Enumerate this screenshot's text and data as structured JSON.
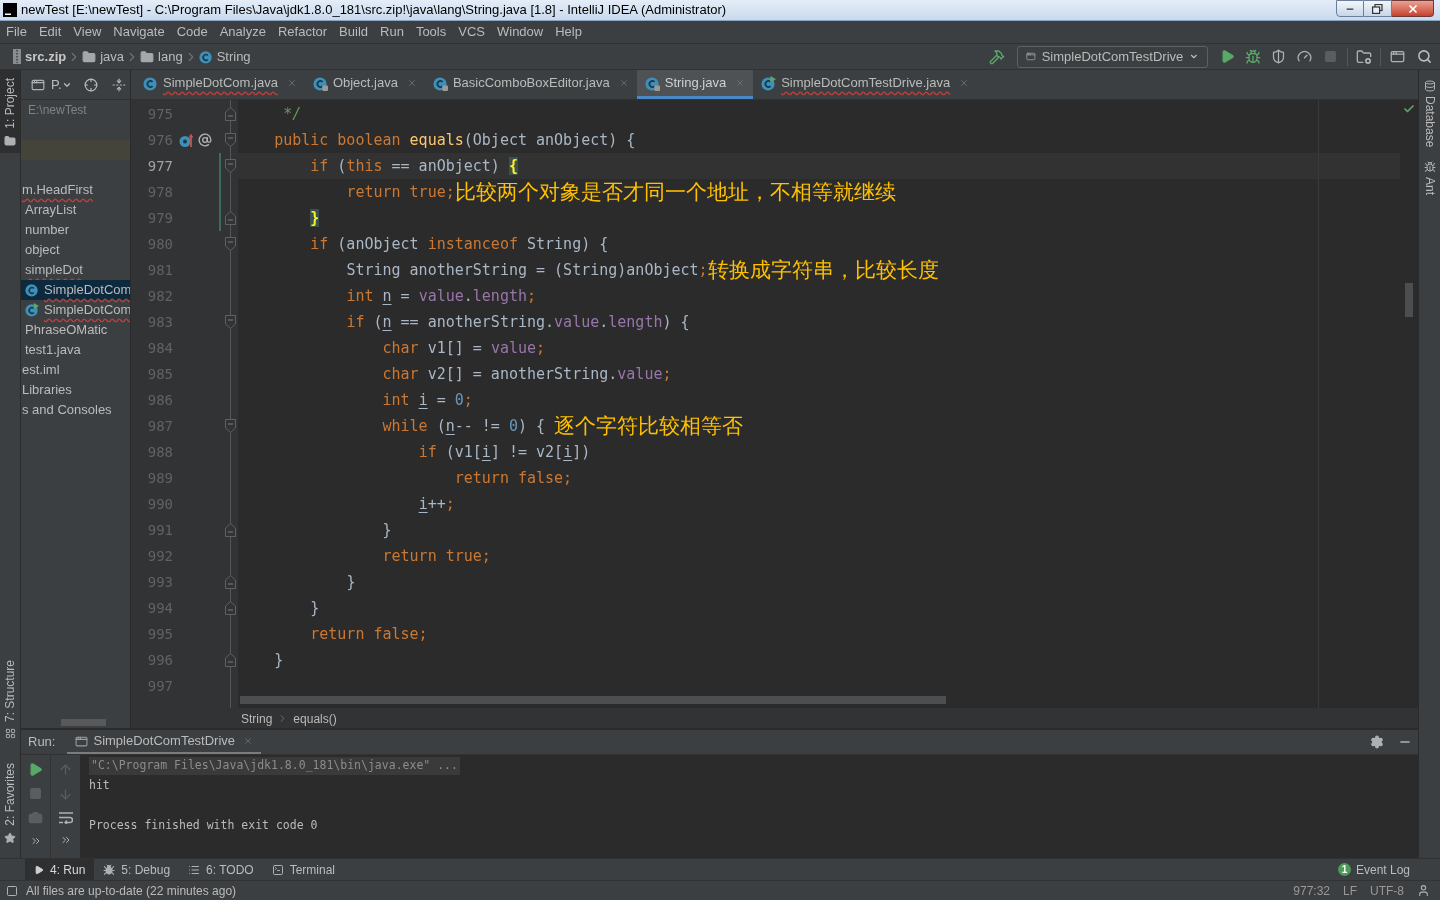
{
  "window": {
    "title": "newTest [E:\\newTest] - C:\\Program Files\\Java\\jdk1.8.0_181\\src.zip!\\java\\lang\\String.java [1.8] - IntelliJ IDEA (Administrator)"
  },
  "menu": [
    "File",
    "Edit",
    "View",
    "Navigate",
    "Code",
    "Analyze",
    "Refactor",
    "Build",
    "Run",
    "Tools",
    "VCS",
    "Window",
    "Help"
  ],
  "navigation": [
    {
      "label": "src.zip",
      "kind": "archive"
    },
    {
      "label": "java",
      "kind": "folder"
    },
    {
      "label": "lang",
      "kind": "folder"
    },
    {
      "label": "String",
      "kind": "class"
    }
  ],
  "run_configuration": {
    "label": "SimpleDotComTestDrive"
  },
  "left_tool_windows": [
    {
      "label": "1: Project",
      "kind": "project",
      "selected": true
    },
    {
      "label": "7: Structure",
      "kind": "structure",
      "selected": false
    },
    {
      "label": "2: Favorites",
      "kind": "favorites",
      "selected": false
    }
  ],
  "right_tool_windows": [
    {
      "label": "Database",
      "kind": "database"
    },
    {
      "label": "Ant",
      "kind": "ant"
    }
  ],
  "project_panel": {
    "view": "P.",
    "root_path": "E:\\newTest",
    "tree": [
      {
        "label": "m.HeadFirst",
        "kind": "plain",
        "error": true,
        "selected": false,
        "children": [
          {
            "label": "ArrayList",
            "kind": "plain",
            "error": false,
            "selected": false
          },
          {
            "label": "number",
            "kind": "plain",
            "error": false,
            "selected": false
          },
          {
            "label": "object",
            "kind": "plain",
            "error": false,
            "selected": false
          },
          {
            "label": "simpleDot",
            "kind": "plain",
            "error": true,
            "selected": false
          },
          {
            "label": "SimpleDotCom",
            "kind": "class",
            "error": true,
            "selected": true
          },
          {
            "label": "SimpleDotCom",
            "kind": "class_run",
            "error": true,
            "selected": false
          },
          {
            "label": "PhraseOMatic",
            "kind": "plain",
            "error": false,
            "selected": false
          },
          {
            "label": "test1.java",
            "kind": "plain",
            "error": false,
            "selected": false
          }
        ]
      },
      {
        "label": "est.iml",
        "kind": "plain",
        "error": false,
        "selected": false
      },
      {
        "label": "Libraries",
        "kind": "plain",
        "error": false,
        "selected": false
      },
      {
        "label": "s and Consoles",
        "kind": "plain",
        "error": false,
        "selected": false
      }
    ]
  },
  "tabs": [
    {
      "label": "SimpleDotCom.java",
      "kind": "class",
      "error": true,
      "selected": false
    },
    {
      "label": "Object.java",
      "kind": "class_locked",
      "error": false,
      "selected": false
    },
    {
      "label": "BasicComboBoxEditor.java",
      "kind": "class_locked",
      "error": false,
      "selected": false
    },
    {
      "label": "String.java",
      "kind": "class_locked",
      "error": false,
      "selected": true
    },
    {
      "label": "SimpleDotComTestDrive.java",
      "kind": "class_run",
      "error": true,
      "selected": false
    }
  ],
  "editor": {
    "lines": [
      {
        "number": "975",
        "current": false,
        "gutter_marks": [
          {
            "kind": "fold_end"
          }
        ],
        "tokens": [
          {
            "text": "     */",
            "kind": "comment"
          }
        ]
      },
      {
        "number": "976",
        "current": false,
        "gutter_marks": [
          {
            "kind": "override"
          },
          {
            "kind": "annotation"
          },
          {
            "kind": "fold_start"
          }
        ],
        "tokens": [
          {
            "text": "    public boolean ",
            "kind": "keyword"
          },
          {
            "text": "equals",
            "kind": "method"
          },
          {
            "text": "(Object anObject) {",
            "kind": "plain"
          }
        ]
      },
      {
        "number": "977",
        "current": true,
        "gutter_marks": [
          {
            "kind": "change"
          },
          {
            "kind": "fold_start"
          }
        ],
        "tokens": [
          {
            "text": "        if ",
            "kind": "keyword"
          },
          {
            "text": "(",
            "kind": "plain"
          },
          {
            "text": "this",
            "kind": "keyword"
          },
          {
            "text": " == anObject) ",
            "kind": "plain"
          },
          {
            "text": "{",
            "kind": "brace_match"
          }
        ]
      },
      {
        "number": "978",
        "current": false,
        "gutter_marks": [
          {
            "kind": "change"
          }
        ],
        "tokens": [
          {
            "text": "            return true;",
            "kind": "keyword"
          },
          {
            "text": "比较两个对象是否才同一个地址，不相等就继续",
            "kind": "note"
          }
        ]
      },
      {
        "number": "979",
        "current": false,
        "gutter_marks": [
          {
            "kind": "change"
          },
          {
            "kind": "fold_end"
          }
        ],
        "tokens": [
          {
            "text": "        }",
            "kind": "brace_match"
          }
        ]
      },
      {
        "number": "980",
        "current": false,
        "gutter_marks": [
          {
            "kind": "fold_start"
          }
        ],
        "tokens": [
          {
            "text": "        if ",
            "kind": "keyword"
          },
          {
            "text": "(anObject ",
            "kind": "plain"
          },
          {
            "text": "instanceof",
            "kind": "keyword"
          },
          {
            "text": " String) {",
            "kind": "plain"
          }
        ]
      },
      {
        "number": "981",
        "current": false,
        "tokens": [
          {
            "text": "            String anotherString = (String)anObject",
            "kind": "plain"
          },
          {
            "text": ";",
            "kind": "keyword"
          },
          {
            "text": "转换成字符串，比较长度",
            "kind": "note"
          }
        ]
      },
      {
        "number": "982",
        "current": false,
        "tokens": [
          {
            "text": "            int ",
            "kind": "keyword"
          },
          {
            "text": "n",
            "kind": "reassigned"
          },
          {
            "text": " = ",
            "kind": "plain"
          },
          {
            "text": "value",
            "kind": "field"
          },
          {
            "text": ".",
            "kind": "plain"
          },
          {
            "text": "length",
            "kind": "field"
          },
          {
            "text": ";",
            "kind": "keyword"
          }
        ]
      },
      {
        "number": "983",
        "current": false,
        "gutter_marks": [
          {
            "kind": "fold_start"
          }
        ],
        "tokens": [
          {
            "text": "            if ",
            "kind": "keyword"
          },
          {
            "text": "(",
            "kind": "plain"
          },
          {
            "text": "n",
            "kind": "reassigned"
          },
          {
            "text": " == anotherString.",
            "kind": "plain"
          },
          {
            "text": "value",
            "kind": "field"
          },
          {
            "text": ".",
            "kind": "plain"
          },
          {
            "text": "length",
            "kind": "field"
          },
          {
            "text": ") {",
            "kind": "plain"
          }
        ]
      },
      {
        "number": "984",
        "current": false,
        "tokens": [
          {
            "text": "                char ",
            "kind": "keyword"
          },
          {
            "text": "v1[] = ",
            "kind": "plain"
          },
          {
            "text": "value",
            "kind": "field"
          },
          {
            "text": ";",
            "kind": "keyword"
          }
        ]
      },
      {
        "number": "985",
        "current": false,
        "tokens": [
          {
            "text": "                char ",
            "kind": "keyword"
          },
          {
            "text": "v2[] = anotherString.",
            "kind": "plain"
          },
          {
            "text": "value",
            "kind": "field"
          },
          {
            "text": ";",
            "kind": "keyword"
          }
        ]
      },
      {
        "number": "986",
        "current": false,
        "tokens": [
          {
            "text": "                int ",
            "kind": "keyword"
          },
          {
            "text": "i",
            "kind": "reassigned"
          },
          {
            "text": " = ",
            "kind": "plain"
          },
          {
            "text": "0",
            "kind": "number"
          },
          {
            "text": ";",
            "kind": "keyword"
          }
        ]
      },
      {
        "number": "987",
        "current": false,
        "gutter_marks": [
          {
            "kind": "fold_start"
          }
        ],
        "tokens": [
          {
            "text": "                while ",
            "kind": "keyword"
          },
          {
            "text": "(",
            "kind": "plain"
          },
          {
            "text": "n",
            "kind": "reassigned"
          },
          {
            "text": "-- != ",
            "kind": "plain"
          },
          {
            "text": "0",
            "kind": "number"
          },
          {
            "text": ") { ",
            "kind": "plain"
          },
          {
            "text": "逐个字符比较相等否",
            "kind": "note"
          }
        ]
      },
      {
        "number": "988",
        "current": false,
        "tokens": [
          {
            "text": "                    if ",
            "kind": "keyword"
          },
          {
            "text": "(v1[",
            "kind": "plain"
          },
          {
            "text": "i",
            "kind": "reassigned"
          },
          {
            "text": "] != v2[",
            "kind": "plain"
          },
          {
            "text": "i",
            "kind": "reassigned"
          },
          {
            "text": "])",
            "kind": "plain"
          }
        ]
      },
      {
        "number": "989",
        "current": false,
        "tokens": [
          {
            "text": "                        return false;",
            "kind": "keyword"
          }
        ]
      },
      {
        "number": "990",
        "current": false,
        "tokens": [
          {
            "text": "                    i",
            "kind": "reassigned"
          },
          {
            "text": "++",
            "kind": "plain"
          },
          {
            "text": ";",
            "kind": "keyword"
          }
        ]
      },
      {
        "number": "991",
        "current": false,
        "gutter_marks": [
          {
            "kind": "fold_end"
          }
        ],
        "tokens": [
          {
            "text": "                }",
            "kind": "plain"
          }
        ]
      },
      {
        "number": "992",
        "current": false,
        "tokens": [
          {
            "text": "                return true;",
            "kind": "keyword"
          }
        ]
      },
      {
        "number": "993",
        "current": false,
        "gutter_marks": [
          {
            "kind": "fold_end"
          }
        ],
        "tokens": [
          {
            "text": "            }",
            "kind": "plain"
          }
        ]
      },
      {
        "number": "994",
        "current": false,
        "gutter_marks": [
          {
            "kind": "fold_end"
          }
        ],
        "tokens": [
          {
            "text": "        }",
            "kind": "plain"
          }
        ]
      },
      {
        "number": "995",
        "current": false,
        "tokens": [
          {
            "text": "        return false;",
            "kind": "keyword"
          }
        ]
      },
      {
        "number": "996",
        "current": false,
        "gutter_marks": [
          {
            "kind": "fold_end"
          }
        ],
        "tokens": [
          {
            "text": "    }",
            "kind": "plain"
          }
        ]
      },
      {
        "number": "997",
        "current": false
      }
    ]
  },
  "editor_breadcrumbs": [
    "String",
    "equals()"
  ],
  "run_panel": {
    "title": "Run:",
    "tab": "SimpleDotComTestDrive",
    "console": [
      {
        "text": "\"C:\\Program Files\\Java\\jdk1.8.0_181\\bin\\java.exe\" ...",
        "kind": "folded_command"
      },
      {
        "text": "hit",
        "kind": "output"
      },
      {
        "text": "Process finished with exit code 0",
        "kind": "exit_status"
      }
    ]
  },
  "bottom_tabs": [
    {
      "label": "4: Run",
      "kind": "run",
      "selected": true
    },
    {
      "label": "5: Debug",
      "kind": "debug",
      "selected": false
    },
    {
      "label": "6: TODO",
      "kind": "todo",
      "selected": false
    },
    {
      "label": "Terminal",
      "kind": "terminal",
      "selected": false
    }
  ],
  "event_log": {
    "label": "Event Log",
    "count": "1"
  },
  "status_bar": {
    "message": "All files are up-to-date (22 minutes ago)",
    "position": "977:32",
    "line_separator": "LF",
    "encoding": "UTF-8"
  }
}
